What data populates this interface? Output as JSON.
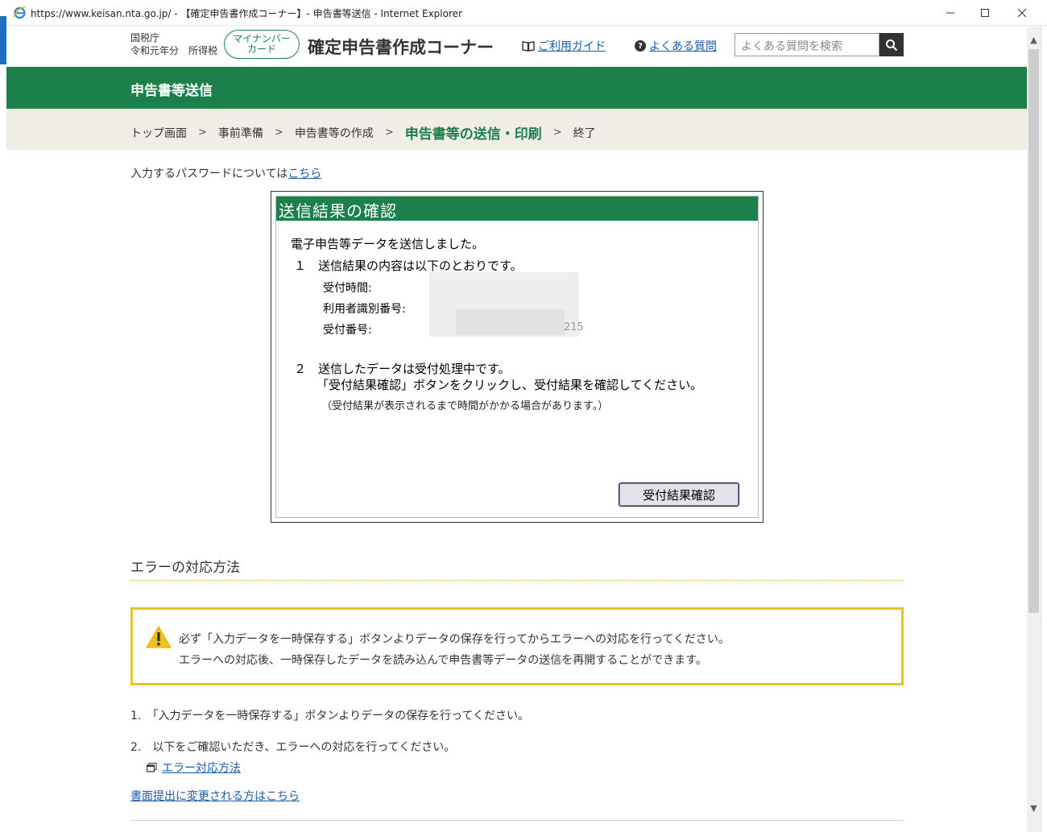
{
  "window": {
    "title": "https://www.keisan.nta.go.jp/ - 【確定申告書作成コーナー】- 申告書等送信 - Internet Explorer"
  },
  "header": {
    "org_line1": "国税庁",
    "org_line2": "令和元年分　所得税",
    "mynumber_line1": "マイナンバー",
    "mynumber_line2": "カード",
    "site_title": "確定申告書作成コーナー",
    "guide_link": "ご利用ガイド",
    "faq_link": "よくある質問",
    "search_placeholder": "よくある質問を検索"
  },
  "page_title": "申告書等送信",
  "breadcrumb": [
    "トップ画面",
    "事前準備",
    "申告書等の作成",
    "申告書等の送信・印刷",
    "終了"
  ],
  "password_note": {
    "text": "入力するパスワードについては",
    "link": "こちら"
  },
  "result_dialog": {
    "title": "送信結果の確認",
    "sent_message": "電子申告等データを送信しました。",
    "item1": "１　送信結果の内容は以下のとおりです。",
    "field_reception_time": "受付時間:",
    "field_user_id": "利用者識別番号:",
    "field_reception_number": "受付番号:",
    "reception_number_tail": "215",
    "item2": "２　送信したデータは受付処理中です。",
    "item2_line2": "「受付結果確認」ボタンをクリックし、受付結果を確認してください。",
    "item2_note": "（受付結果が表示されるまで時間がかかる場合があります。）",
    "button": "受付結果確認"
  },
  "error_section": {
    "title": "エラーの対応方法",
    "warning_line1": "必ず「入力データを一時保存する」ボタンよりデータの保存を行ってからエラーへの対応を行ってください。",
    "warning_line2": "エラーへの対応後、一時保存したデータを読み込んで申告書等データの送信を再開することができます。",
    "step1": "1.　「入力データを一時保存する」ボタンよりデータの保存を行ってください。",
    "step2": "2.　以下をご確認いただき、エラーへの対応を行ってください。",
    "error_link": "エラー対応方法",
    "paper_link": "書面提出に変更される方はこちら"
  }
}
